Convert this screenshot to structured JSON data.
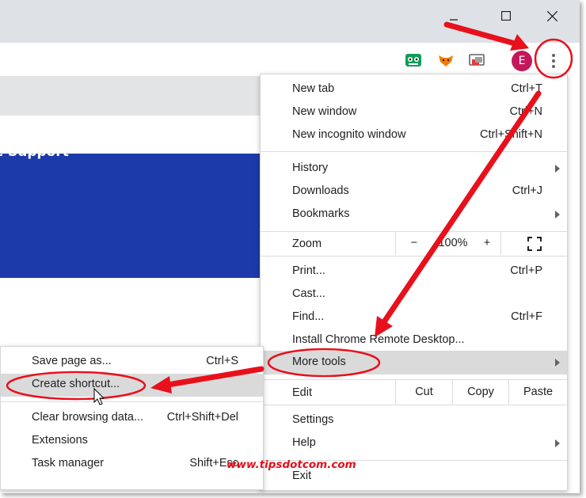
{
  "window": {
    "avatar_letter": "E",
    "blue_banner_text": "c Support"
  },
  "menu": {
    "items_top": [
      {
        "label": "New tab",
        "shortcut": "Ctrl+T"
      },
      {
        "label": "New window",
        "shortcut": "Ctrl+N"
      },
      {
        "label": "New incognito window",
        "shortcut": "Ctrl+Shift+N"
      }
    ],
    "history": {
      "label": "History"
    },
    "downloads": {
      "label": "Downloads",
      "shortcut": "Ctrl+J"
    },
    "bookmarks": {
      "label": "Bookmarks"
    },
    "zoom": {
      "label": "Zoom",
      "minus": "−",
      "value": "100%",
      "plus": "+"
    },
    "print": {
      "label": "Print...",
      "shortcut": "Ctrl+P"
    },
    "cast": {
      "label": "Cast..."
    },
    "find": {
      "label": "Find...",
      "shortcut": "Ctrl+F"
    },
    "install": {
      "label": "Install Chrome Remote Desktop..."
    },
    "more_tools": {
      "label": "More tools"
    },
    "edit": {
      "label": "Edit",
      "cut": "Cut",
      "copy": "Copy",
      "paste": "Paste"
    },
    "settings": {
      "label": "Settings"
    },
    "help": {
      "label": "Help"
    },
    "exit": {
      "label": "Exit"
    }
  },
  "submenu": {
    "items": [
      {
        "label": "Save page as...",
        "shortcut": "Ctrl+S"
      },
      {
        "label": "Create shortcut...",
        "shortcut": ""
      },
      {
        "label": "Clear browsing data...",
        "shortcut": "Ctrl+Shift+Del"
      },
      {
        "label": "Extensions",
        "shortcut": ""
      },
      {
        "label": "Task manager",
        "shortcut": "Shift+Esc"
      }
    ]
  },
  "watermark": "www.tipsdotcom.com",
  "colors": {
    "annotation_red": "#e8101b",
    "banner_blue": "#1c3aa9",
    "avatar": "#c2185b",
    "highlight": "#dadada"
  },
  "icons": [
    "minimize-icon",
    "maximize-icon",
    "close-icon",
    "extension-green-icon",
    "extension-fox-icon",
    "cast-extension-icon",
    "kebab-menu-icon",
    "fullscreen-icon",
    "chevron-right-icon"
  ]
}
